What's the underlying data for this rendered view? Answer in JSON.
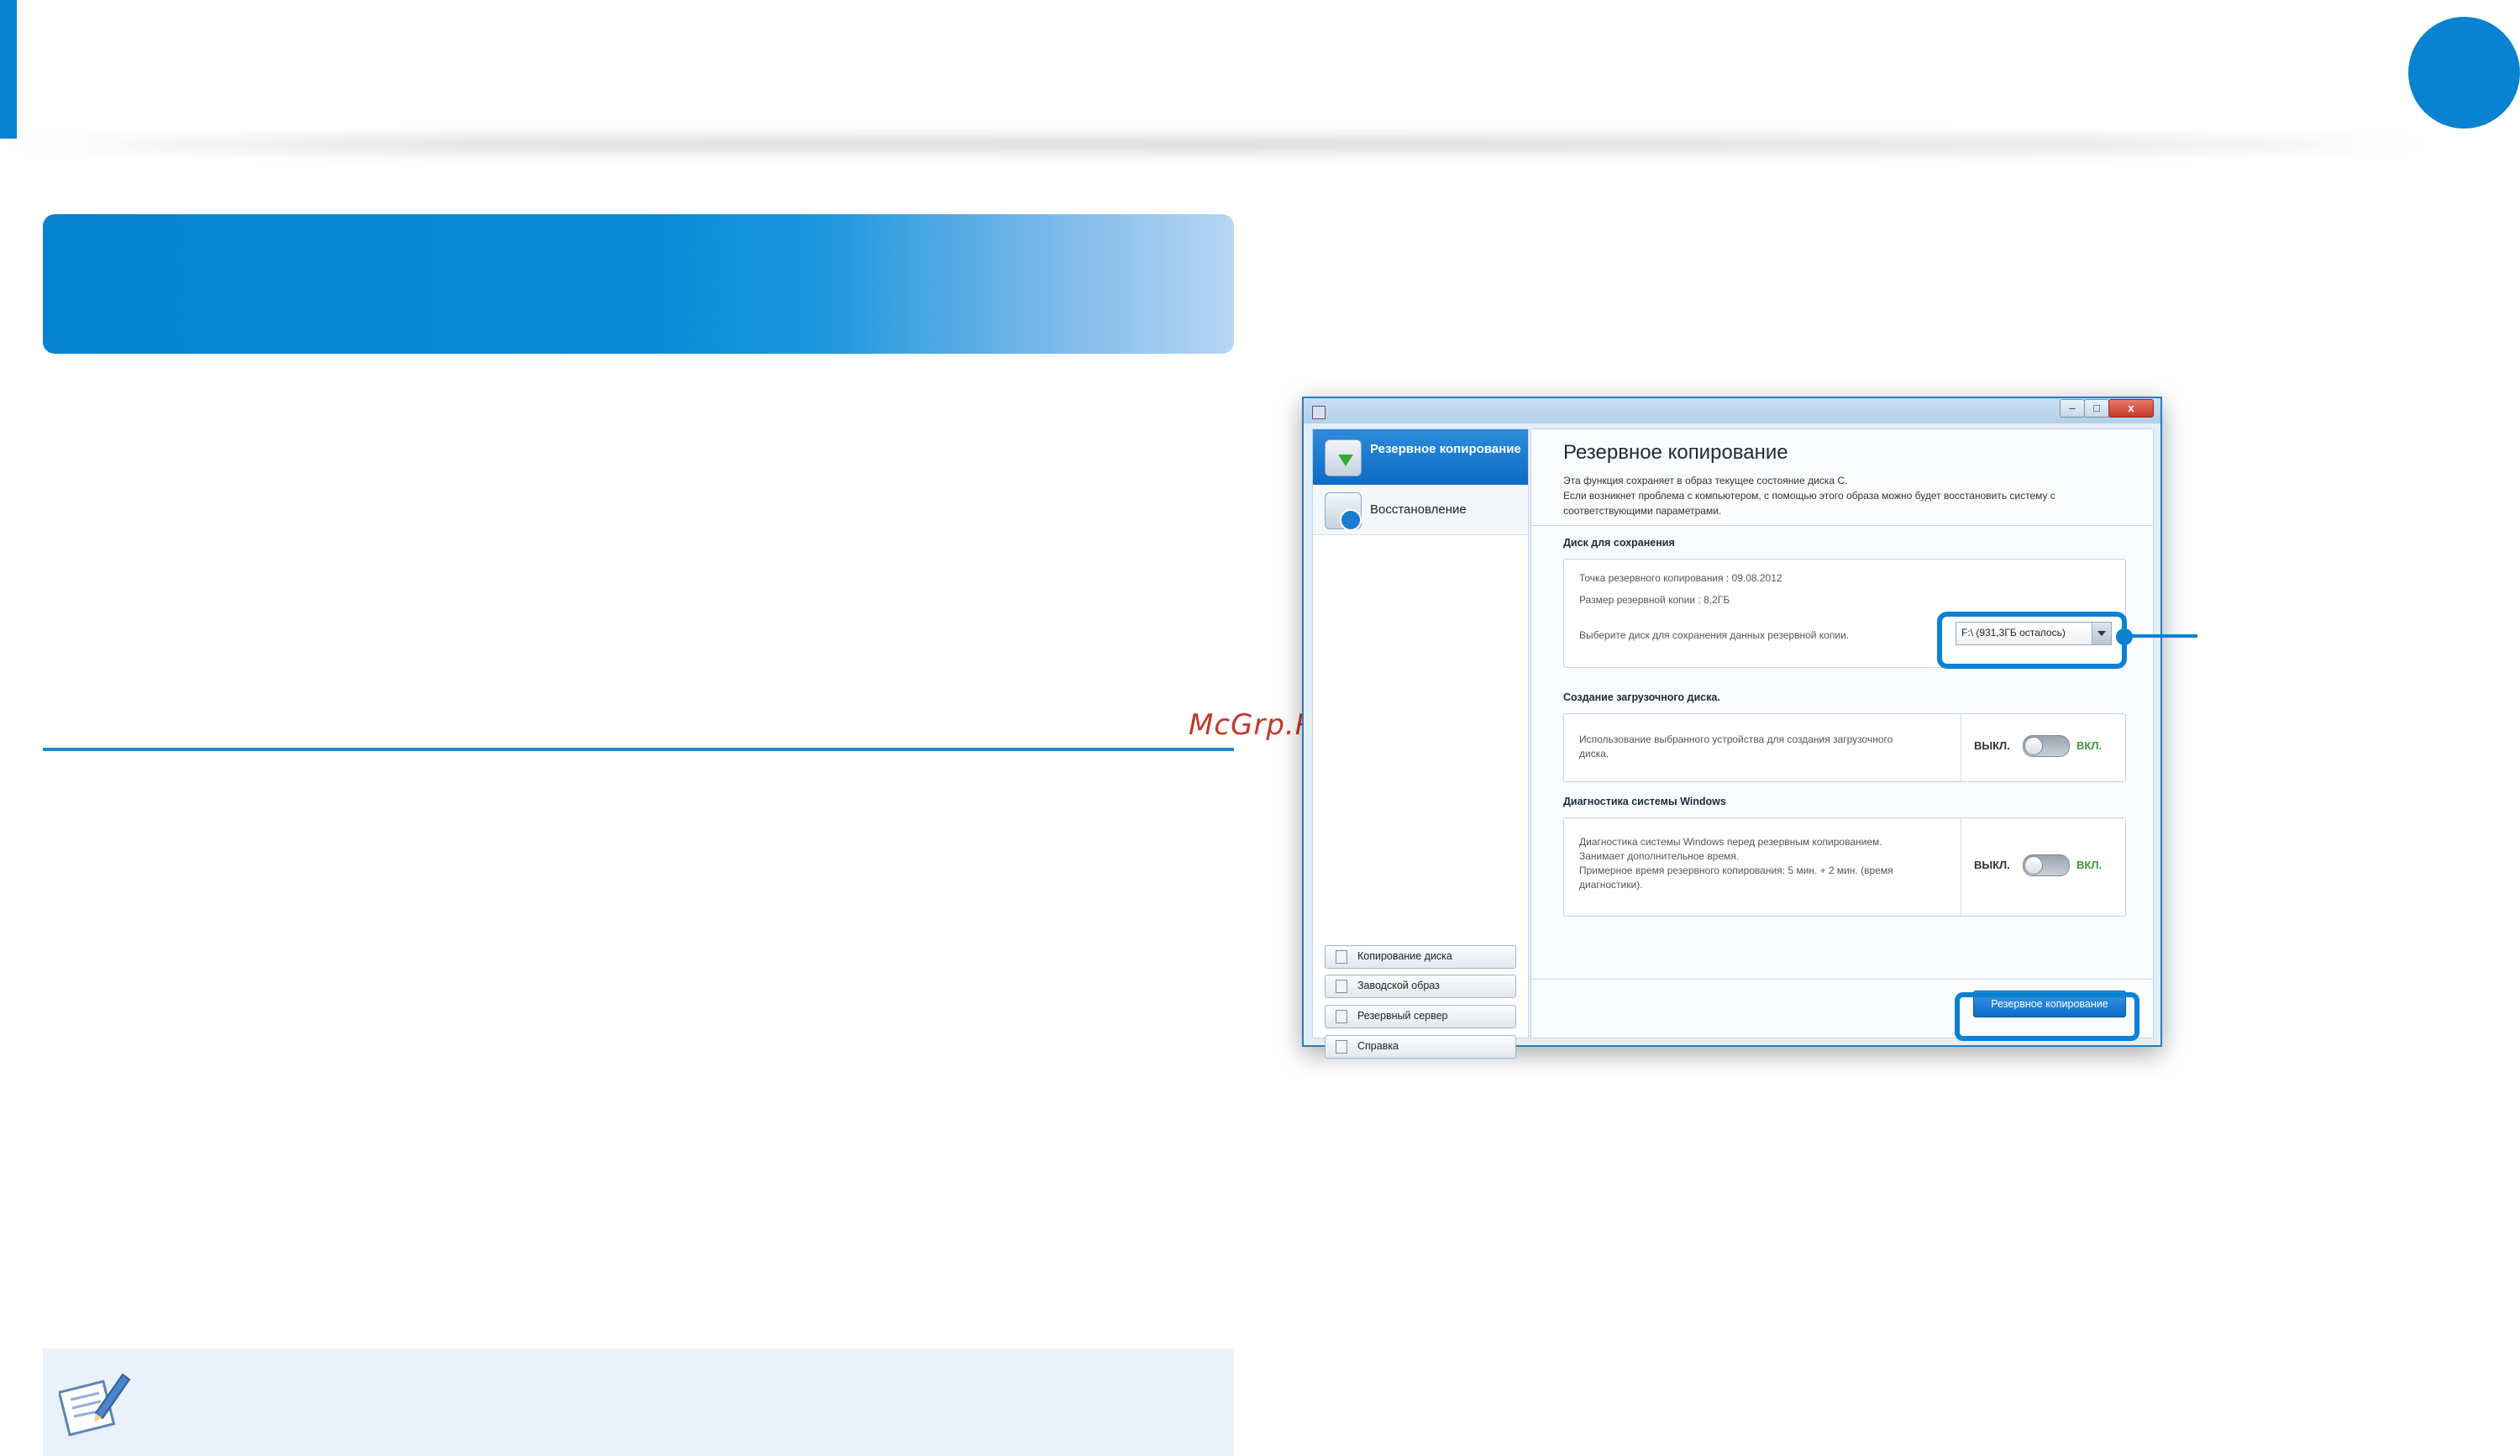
{
  "watermark": "McGrp.Ru",
  "window": {
    "minimize": "–",
    "maximize": "□",
    "close": "x"
  },
  "sidebar": {
    "items": [
      {
        "label": "Резервное копирование"
      },
      {
        "label": "Восстановление"
      }
    ],
    "buttons": [
      {
        "label": "Копирование диска"
      },
      {
        "label": "Заводской образ"
      },
      {
        "label": "Резервный сервер"
      },
      {
        "label": "Справка"
      }
    ]
  },
  "content": {
    "title": "Резервное копирование",
    "desc": [
      "Эта функция сохраняет в образ текущее состояние диска С.",
      "Если возникнет проблема с компьютером, с помощью этого образа можно будет восстановить систему с",
      "соответствующими параметрами."
    ],
    "save_disk": {
      "title": "Диск для сохранения",
      "backup_point": "Точка резервного копирования : 09.08.2012",
      "backup_size": "Размер резервной копии : 8,2ГБ",
      "choose_disk": "Выберите диск для сохранения данных резервной копии.",
      "drive_value": "F:\\ (931,3ГБ осталось)"
    },
    "boot_disk": {
      "title": "Создание загрузочного диска.",
      "text_1": "Использование выбранного устройства для создания загрузочного",
      "text_2": "диска.",
      "off": "ВЫКЛ.",
      "on": "ВКЛ."
    },
    "diagnostics": {
      "title": "Диагностика системы Windows",
      "text_1": "Диагностика системы Windows перед резервным копированием.",
      "text_2": "Занимает дополнительное время.",
      "text_3": "Примерное время резервного копирования: 5 мин. + 2 мин. (время",
      "text_4": "диагностики).",
      "off": "ВЫКЛ.",
      "on": "ВКЛ."
    },
    "backup_button": "Резервное копирование"
  }
}
